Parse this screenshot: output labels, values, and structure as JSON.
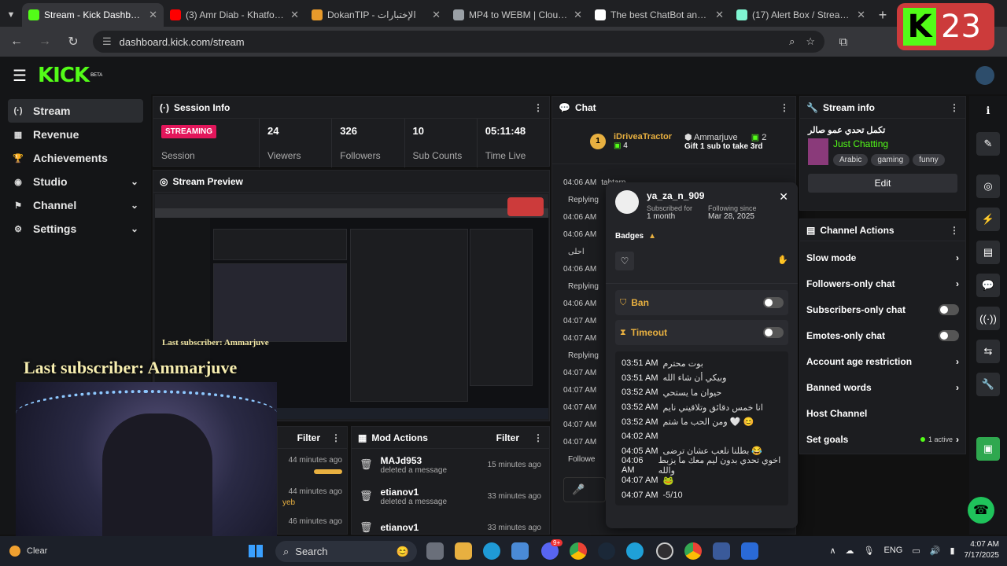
{
  "browser": {
    "tabs": [
      {
        "title": "Stream - Kick Dashboard",
        "icon": "kick-icon",
        "color": "#53fc18",
        "active": true
      },
      {
        "title": "(3) Amr Diab - Khatfoony (",
        "icon": "youtube-icon",
        "color": "#ff0000",
        "active": false
      },
      {
        "title": "DokanTIP - الإختبارات",
        "icon": "dokan-icon",
        "color": "#e89a2b",
        "active": false
      },
      {
        "title": "MP4 to WEBM | CloudConv",
        "icon": "cloudconvert-icon",
        "color": "#9aa0a6",
        "active": false
      },
      {
        "title": "The best ChatBot and Wid",
        "icon": "botrix-icon",
        "color": "#ffffff",
        "active": false
      },
      {
        "title": "(17) Alert Box / Streamlabs",
        "icon": "streamlabs-icon",
        "color": "#80f5d2",
        "active": false
      }
    ],
    "url": "dashboard.kick.com/stream"
  },
  "overlay": {
    "k_letter": "K",
    "count": "23"
  },
  "app": {
    "logo": "KICK",
    "beta": "BETA"
  },
  "nav": [
    {
      "label": "Stream",
      "icon": "stream-icon",
      "glyph": "(·)",
      "active": true,
      "expandable": false
    },
    {
      "label": "Revenue",
      "icon": "revenue-icon",
      "glyph": "▦",
      "active": false,
      "expandable": false
    },
    {
      "label": "Achievements",
      "icon": "trophy-icon",
      "glyph": "🏆",
      "active": false,
      "expandable": false
    },
    {
      "label": "Studio",
      "icon": "studio-icon",
      "glyph": "◉",
      "active": false,
      "expandable": true
    },
    {
      "label": "Channel",
      "icon": "channel-icon",
      "glyph": "⚑",
      "active": false,
      "expandable": true
    },
    {
      "label": "Settings",
      "icon": "settings-icon",
      "glyph": "⚙",
      "active": false,
      "expandable": true
    }
  ],
  "session": {
    "title": "Session Info",
    "status": "STREAMING",
    "session_label": "Session",
    "stats": [
      {
        "value": "24",
        "label": "Viewers"
      },
      {
        "value": "326",
        "label": "Followers"
      },
      {
        "value": "10",
        "label": "Sub Counts"
      },
      {
        "value": "05:11:48",
        "label": "Time Live"
      }
    ]
  },
  "preview": {
    "title": "Stream Preview"
  },
  "webcam": {
    "small_label": "Last subscriber: Ammarjuve",
    "big_label": "Last subscriber: Ammarjuve"
  },
  "filter_panel": {
    "title": "Filter",
    "rows": [
      {
        "time": "44 minutes ago"
      },
      {
        "time": "44 minutes ago",
        "snippet": "yeb"
      },
      {
        "time": "46 minutes ago"
      }
    ]
  },
  "mod_actions": {
    "title": "Mod Actions",
    "filter": "Filter",
    "rows": [
      {
        "user": "MAJd953",
        "action": "deleted a message",
        "time": "15 minutes ago"
      },
      {
        "user": "etianov1",
        "action": "deleted a message",
        "time": "33 minutes ago"
      },
      {
        "user": "etianov1",
        "action": "",
        "time": "33 minutes ago"
      }
    ]
  },
  "chat": {
    "title": "Chat",
    "pinned": {
      "gifter": "iDriveaTractor",
      "gifter_count": "4",
      "gifter_rank": "1",
      "receiver": "Ammarjuve",
      "receiver_count": "2",
      "message": "Gift 1 sub to take 3rd"
    },
    "lines": [
      {
        "time": "04:06 AM",
        "text": "tahtarn"
      },
      {
        "time": "",
        "text": "Replying"
      },
      {
        "time": "04:06 AM",
        "text": ""
      },
      {
        "time": "04:06 AM",
        "text": ""
      },
      {
        "time": "",
        "text": "احلى"
      },
      {
        "time": "04:06 AM",
        "text": ""
      },
      {
        "time": "",
        "text": "Replying"
      },
      {
        "time": "04:06 AM",
        "text": ""
      },
      {
        "time": "04:07 AM",
        "text": ""
      },
      {
        "time": "04:07 AM",
        "text": ""
      },
      {
        "time": "",
        "text": "Replying"
      },
      {
        "time": "04:07 AM",
        "text": ""
      },
      {
        "time": "04:07 AM",
        "text": ""
      },
      {
        "time": "04:07 AM",
        "text": ""
      },
      {
        "time": "04:07 AM",
        "text": ""
      },
      {
        "time": "04:07 AM",
        "text": ""
      },
      {
        "time": "",
        "text": "Followe"
      }
    ]
  },
  "user_popup": {
    "username": "ya_za_n_909",
    "subscribed_label": "Subscribed for",
    "subscribed_value": "1 month",
    "following_label": "Following since",
    "following_value": "Mar 28, 2025",
    "badges_label": "Badges",
    "ban_label": "Ban",
    "timeout_label": "Timeout",
    "log": [
      {
        "time": "03:51 AM",
        "text": "بوت محترم"
      },
      {
        "time": "03:51 AM",
        "text": "وبيكي أن شاء الله"
      },
      {
        "time": "03:52 AM",
        "text": "حيوان ما يستحي"
      },
      {
        "time": "03:52 AM",
        "text": "انا خمس دقائق وتلاقيني نايم"
      },
      {
        "time": "03:52 AM",
        "text": "ومن الحب ما شتم 🤍 😊"
      },
      {
        "time": "04:02 AM",
        "text": ""
      },
      {
        "time": "04:05 AM",
        "text": "بطلنا نلعب عشان ترضى 😂"
      },
      {
        "time": "04:06 AM",
        "text": "اخوي تحدي بدون ليم معك ما يزبط والله"
      },
      {
        "time": "04:07 AM",
        "text": "🐸"
      },
      {
        "time": "04:07 AM",
        "text": "-5/10"
      }
    ]
  },
  "stream_info": {
    "title": "Stream info",
    "stream_title": "تكمل تحدي عمو صالر",
    "category": "Just Chatting",
    "tags": [
      "Arabic",
      "gaming",
      "funny"
    ],
    "edit_label": "Edit"
  },
  "channel_actions": {
    "title": "Channel Actions",
    "items": [
      {
        "label": "Slow mode",
        "kind": "arrow"
      },
      {
        "label": "Followers-only chat",
        "kind": "arrow"
      },
      {
        "label": "Subscribers-only chat",
        "kind": "toggle"
      },
      {
        "label": "Emotes-only chat",
        "kind": "toggle"
      },
      {
        "label": "Account age restriction",
        "kind": "arrow"
      },
      {
        "label": "Banned words",
        "kind": "arrow"
      },
      {
        "label": "Host Channel",
        "kind": "none"
      },
      {
        "label": "Set goals",
        "kind": "goals",
        "extra": "1 active"
      }
    ]
  },
  "rail": [
    {
      "icon": "info-icon",
      "glyph": "ℹ"
    },
    {
      "icon": "edit-icon",
      "glyph": "✎"
    },
    {
      "icon": "camera-icon",
      "glyph": "◎"
    },
    {
      "icon": "lightning-icon",
      "glyph": "⚡"
    },
    {
      "icon": "notes-icon",
      "glyph": "▤"
    },
    {
      "icon": "chat-bubble-icon",
      "glyph": "💬"
    },
    {
      "icon": "broadcast-icon",
      "glyph": "((·))"
    },
    {
      "icon": "layout-icon",
      "glyph": "⇆"
    },
    {
      "icon": "wrench-icon",
      "glyph": "🔧"
    },
    {
      "icon": "app-icon",
      "glyph": "▣"
    }
  ],
  "taskbar": {
    "weather": "Clear",
    "search": "Search",
    "lang": "ENG",
    "time": "4:07 AM",
    "date": "7/17/2025",
    "discord_badge": "9+"
  }
}
